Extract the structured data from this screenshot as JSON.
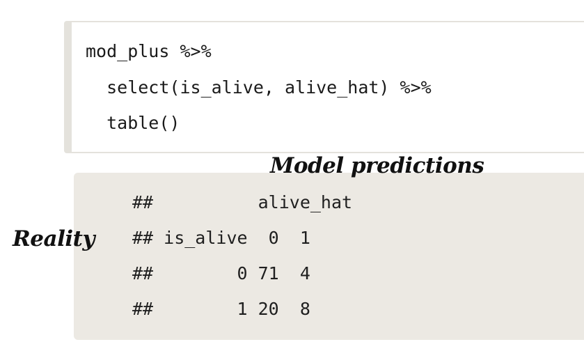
{
  "code": {
    "lines": [
      "mod_plus %>%",
      "  select(is_alive, alive_hat) %>%",
      "  table()"
    ]
  },
  "output": {
    "lines": [
      "##          alive_hat",
      "## is_alive  0  1",
      "##        0 71  4",
      "##        1 20  8"
    ]
  },
  "annotations": {
    "top": "Model predictions",
    "left": "Reality"
  }
}
